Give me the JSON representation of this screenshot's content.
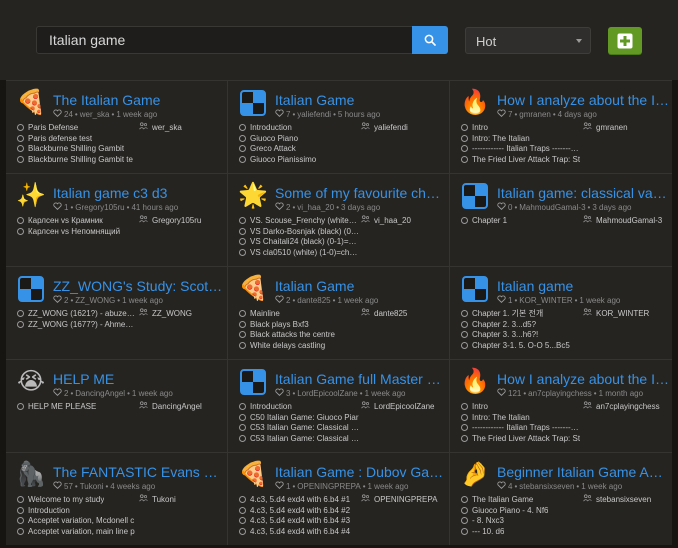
{
  "search": {
    "value": "Italian game"
  },
  "sort": {
    "selected": "Hot"
  },
  "colors": {
    "accent": "#3692e7",
    "add": "#629924"
  },
  "studies": [
    {
      "icon": "pizza-icon",
      "glyph": "🍕",
      "title": "The Italian Game",
      "likes": "24",
      "owner": "wer_ska",
      "updated": "1 week ago",
      "chapters": [
        "Paris Defense",
        "Paris defense test",
        "Blackburne Shilling Gambit",
        "Blackburne Shilling Gambit te"
      ],
      "members": [
        "wer_ska"
      ]
    },
    {
      "icon": "chessboard-icon",
      "glyph": "",
      "title": "Italian Game",
      "likes": "7",
      "owner": "yaliefendi",
      "updated": "5 hours ago",
      "chapters": [
        "Introduction",
        "Giuoco Piano",
        "Greco Attack",
        "Giuoco Pianissimo"
      ],
      "members": [
        "yaliefendi"
      ]
    },
    {
      "icon": "fire-icon",
      "glyph": "🔥",
      "title": "How I analyze about the Itali…",
      "likes": "7",
      "owner": "gmranen",
      "updated": "4 days ago",
      "chapters": [
        "Intro",
        "Intro: The Italian",
        "------------ Italian Traps -----------",
        "The Fried Liver Attack Trap: St"
      ],
      "members": [
        "gmranen"
      ]
    },
    {
      "icon": "sparkle-ring-icon",
      "glyph": "✨",
      "title": "Italian game c3 d3",
      "likes": "1",
      "owner": "Gregory105ru",
      "updated": "41 hours ago",
      "chapters": [
        "Карлсен vs Крамник",
        "Карлсен vs Непомнящий"
      ],
      "members": [
        "Gregory105ru"
      ]
    },
    {
      "icon": "star-icon",
      "glyph": "🌟",
      "title": "Some of my favourite chess…",
      "likes": "2",
      "owner": "vi_haa_20",
      "updated": "3 days ago",
      "chapters": [
        "VS. Scouse_Frenchy (white). (1-0)",
        "VS Darko-Bosnjak (black) (0-1)",
        "VS Chaitali24 (black) (0-1)=chess",
        "VS cla0510 (white) (1-0)=chess"
      ],
      "members": [
        "vi_haa_20"
      ]
    },
    {
      "icon": "chessboard-icon",
      "glyph": "",
      "title": "Italian game: classical varia…",
      "likes": "0",
      "owner": "MahmoudGamal-3",
      "updated": "3 days ago",
      "chapters": [
        "Chapter 1"
      ],
      "members": [
        "MahmoudGamal-3"
      ]
    },
    {
      "icon": "chessboard-icon",
      "glyph": "",
      "title": "ZZ_WONG's Study: Scotch …",
      "likes": "2",
      "owner": "ZZ_WONG",
      "updated": "1 week ago",
      "chapters": [
        "ZZ_WONG (1621?) - abuzer_kc",
        "ZZ_WONG (1677?) - AhmedBe"
      ],
      "members": [
        "ZZ_WONG"
      ]
    },
    {
      "icon": "pizza-icon",
      "glyph": "🍕",
      "title": "Italian Game",
      "likes": "2",
      "owner": "dante825",
      "updated": "1 week ago",
      "chapters": [
        "Mainline",
        "Black plays Bxf3",
        "Black attacks the centre",
        "White delays castling"
      ],
      "members": [
        "dante825"
      ]
    },
    {
      "icon": "chessboard-icon",
      "glyph": "",
      "title": "Italian game",
      "likes": "1",
      "owner": "KOR_WINTER",
      "updated": "1 week ago",
      "chapters": [
        "Chapter 1. 기본 전개",
        "Chapter 2. 3...d5?",
        "Chapter 3. 3...h6?!",
        "Chapter 3-1. 5. O-O 5...Bc5"
      ],
      "members": [
        "KOR_WINTER"
      ]
    },
    {
      "icon": "crying-face-icon",
      "glyph": "😭",
      "title": "HELP ME",
      "likes": "2",
      "owner": "DancingAngel",
      "updated": "1 week ago",
      "chapters": [
        "HELP ME PLEASE"
      ],
      "members": [
        "DancingAngel"
      ]
    },
    {
      "icon": "chessboard-icon",
      "glyph": "",
      "title": "Italian Game full Master cla…",
      "likes": "3",
      "owner": "LordEpicoolZane",
      "updated": "1 week ago",
      "chapters": [
        "Introduction",
        "C50 Italian Game: Giuoco Piar",
        "C53 Italian Game: Classical Va",
        "C53 Italian Game: Classical Va"
      ],
      "members": [
        "LordEpicoolZane"
      ]
    },
    {
      "icon": "fire-icon",
      "glyph": "🔥",
      "title": "How I analyze about the Itali…",
      "likes": "121",
      "owner": "an7cplayingchess",
      "updated": "1 month ago",
      "chapters": [
        "Intro",
        "Intro: The Italian",
        "------------ Italian Traps -----------",
        "The Fried Liver Attack Trap: St"
      ],
      "members": [
        "an7cplayingchess"
      ]
    },
    {
      "icon": "gorilla-icon",
      "glyph": "🦍",
      "title": "The FANTASTIC Evans gam…",
      "likes": "57",
      "owner": "Tukoni",
      "updated": "4 weeks ago",
      "chapters": [
        "Welcome to my study",
        "Introduction",
        "Acceptet variation, Mcdonell c",
        "Acceptet variation, main line p"
      ],
      "members": [
        "Tukoni"
      ]
    },
    {
      "icon": "pizza-icon",
      "glyph": "🍕",
      "title": "Italian Game : Dubov Gambit",
      "likes": "1",
      "owner": "OPENINGPREPA",
      "updated": "1 week ago",
      "chapters": [
        "4.c3, 5.d4 exd4 with 6.b4 #1",
        "4.c3, 5.d4 exd4 with 6.b4 #2",
        "4.c3, 5.d4 exd4 with 6.b4 #3",
        "4.c3, 5.d4 exd4 with 6.b4 #4"
      ],
      "members": [
        "OPENINGPREPA"
      ]
    },
    {
      "icon": "pinching-hand-icon",
      "glyph": "🤌",
      "title": "Beginner Italian Game Aggr…",
      "likes": "4",
      "owner": "stebansixseven",
      "updated": "1 week ago",
      "chapters": [
        "The Italian Game",
        "Giuoco Piano - 4. Nf6",
        "- 8. Nxc3",
        "--- 10. d6"
      ],
      "members": [
        "stebansixseven"
      ]
    }
  ]
}
